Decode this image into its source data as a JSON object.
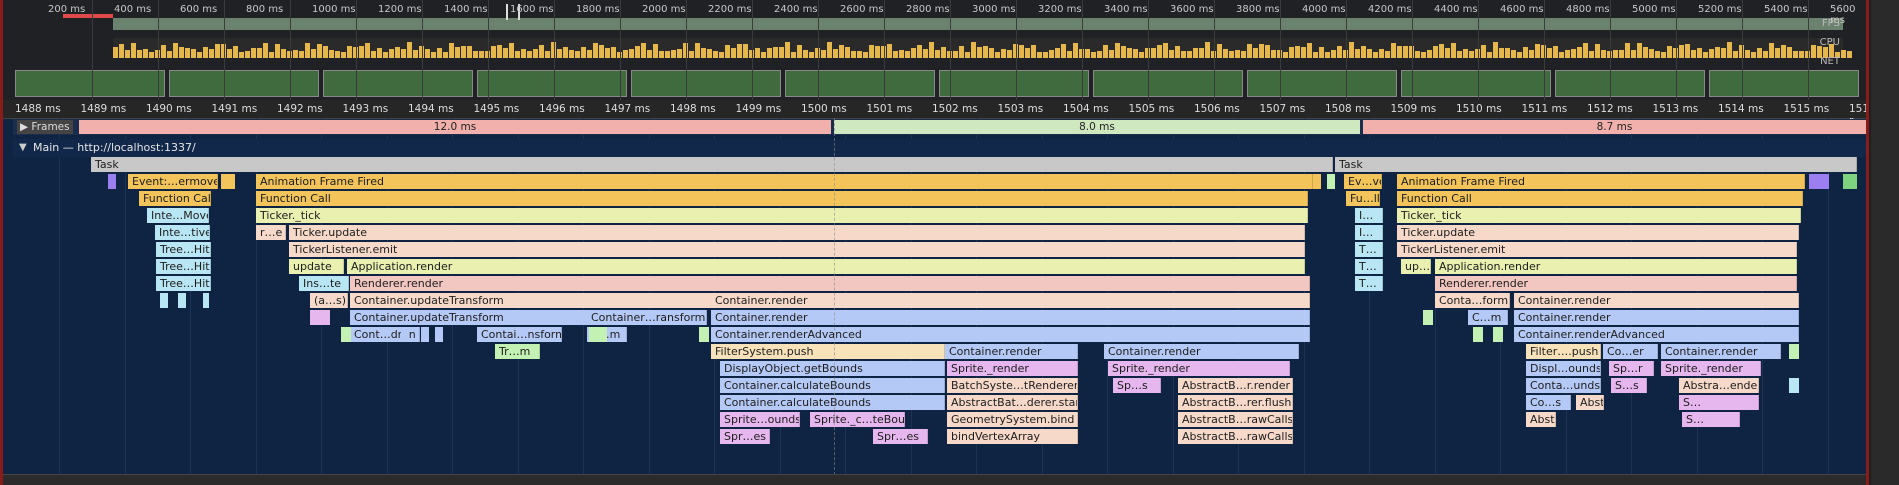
{
  "overview": {
    "ticks": [
      "200 ms",
      "400 ms",
      "600 ms",
      "800 ms",
      "1000 ms",
      "1200 ms",
      "1400 ms",
      "1600 ms",
      "1800 ms",
      "2000 ms",
      "2200 ms",
      "2400 ms",
      "2600 ms",
      "2800 ms",
      "3000 ms",
      "3200 ms",
      "3400 ms",
      "3600 ms",
      "3800 ms",
      "4000 ms",
      "4200 ms",
      "4400 ms",
      "4600 ms",
      "4800 ms",
      "5000 ms",
      "5200 ms",
      "5400 ms",
      "5600 ms"
    ],
    "fps_label": "FPS",
    "cpu_label": "CPU",
    "net_label": "NET",
    "colors": {
      "fps": "#a9d4ad",
      "cpu": "#e6b74a",
      "selection": "#5a5a5a"
    }
  },
  "ruler": {
    "ticks": [
      "1488 ms",
      "1489 ms",
      "1490 ms",
      "1491 ms",
      "1492 ms",
      "1493 ms",
      "1494 ms",
      "1495 ms",
      "1496 ms",
      "1497 ms",
      "1498 ms",
      "1499 ms",
      "1500 ms",
      "1501 ms",
      "1502 ms",
      "1503 ms",
      "1504 ms",
      "1505 ms",
      "1506 ms",
      "1507 ms",
      "1508 ms",
      "1509 ms",
      "1510 ms",
      "1511 ms",
      "1512 ms",
      "1513 ms",
      "1514 ms",
      "1515 ms",
      "1516 r"
    ]
  },
  "frames": {
    "label": "Frames",
    "cells": [
      "12.0 ms",
      "8.0 ms",
      "8.7 ms"
    ],
    "colors": {
      "dropped": "#f2b0ac",
      "ok": "#cfe8c0"
    }
  },
  "main": {
    "title": "Main — http://localhost:1337/"
  },
  "flame": {
    "task1": "Task",
    "task2": "Task",
    "blocks": [
      {
        "t": "Event:…ermove",
        "c": "#f2c45a"
      },
      {
        "t": "Function Call",
        "c": "#f2c45a"
      },
      {
        "t": "Inte…Move",
        "c": "#b9e6f4"
      },
      {
        "t": "Inte…tive",
        "c": "#b9e6f4"
      },
      {
        "t": "Tree…Hit",
        "c": "#b9e6f4"
      },
      {
        "t": "Tree…Hit",
        "c": "#b9e6f4"
      },
      {
        "t": "Tree…Hit",
        "c": "#b9e6f4"
      },
      {
        "t": "Animation Frame Fired",
        "c": "#f2c45a"
      },
      {
        "t": "Function Call",
        "c": "#f2c45a"
      },
      {
        "t": "Ticker._tick",
        "c": "#e9f0b0"
      },
      {
        "t": "r…e",
        "c": "#f6d9c9"
      },
      {
        "t": "Ticker.update",
        "c": "#f6d9c9"
      },
      {
        "t": "TickerListener.emit",
        "c": "#f6d9c9"
      },
      {
        "t": "update",
        "c": "#e9f0b0"
      },
      {
        "t": "Application.render",
        "c": "#e9f0b0"
      },
      {
        "t": "Ins…te",
        "c": "#b9e6f4"
      },
      {
        "t": "Renderer.render",
        "c": "#f2c6c1"
      },
      {
        "t": "(a…s)",
        "c": "#f6d9c9"
      },
      {
        "t": "Container.updateTransform",
        "c": "#f6d9c9"
      },
      {
        "t": "Container.render",
        "c": "#f6d9c9"
      },
      {
        "t": "Container.updateTransform",
        "c": "#b5c9f6"
      },
      {
        "t": "Container…ransform",
        "c": "#b5c9f6"
      },
      {
        "t": "Container.render",
        "c": "#b5c9f6"
      },
      {
        "t": "Cont…dren",
        "c": "#b5c9f6"
      },
      {
        "t": "Contai…nsform",
        "c": "#b5c9f6"
      },
      {
        "t": "C…m",
        "c": "#b5c9f6"
      },
      {
        "t": "Container.renderAdvanced",
        "c": "#b5c9f6"
      },
      {
        "t": "Tr…m",
        "c": "#c3f0b3"
      },
      {
        "t": "FilterSystem.push",
        "c": "#f7e2b9"
      },
      {
        "t": "Container.render",
        "c": "#b5c9f6"
      },
      {
        "t": "Container.render",
        "c": "#b5c9f6"
      },
      {
        "t": "DisplayObject.getBounds",
        "c": "#b5c9f6"
      },
      {
        "t": "Sprite._render",
        "c": "#e6b6ee"
      },
      {
        "t": "Sprite._render",
        "c": "#e6b6ee"
      },
      {
        "t": "Container.calculateBounds",
        "c": "#b5c9f6"
      },
      {
        "t": "BatchSyste…tRenderer",
        "c": "#f6d9c9"
      },
      {
        "t": "Sp…s",
        "c": "#e6b6ee"
      },
      {
        "t": "AbstractB…r.render",
        "c": "#f6d9c9"
      },
      {
        "t": "Container.calculateBounds",
        "c": "#b5c9f6"
      },
      {
        "t": "AbstractBat…derer.start",
        "c": "#f6d9c9"
      },
      {
        "t": "AbstractB…rer.flush",
        "c": "#f6d9c9"
      },
      {
        "t": "Sprite…ounds",
        "c": "#e6b6ee"
      },
      {
        "t": "Sprite._c…teBounds",
        "c": "#e6b6ee"
      },
      {
        "t": "GeometrySystem.bind",
        "c": "#f6d9c9"
      },
      {
        "t": "AbstractB…rawCalls",
        "c": "#f6d9c9"
      },
      {
        "t": "Spr…es",
        "c": "#e6b6ee"
      },
      {
        "t": "Spr…es",
        "c": "#e6b6ee"
      },
      {
        "t": "bindVertexArray",
        "c": "#f6d9c9"
      },
      {
        "t": "AbstractB…rawCalls",
        "c": "#f6d9c9"
      },
      {
        "t": "Ev…ve",
        "c": "#f2c45a"
      },
      {
        "t": "Fu…ll",
        "c": "#f2c45a"
      },
      {
        "t": "I…",
        "c": "#b9e6f4"
      },
      {
        "t": "I…",
        "c": "#b9e6f4"
      },
      {
        "t": "T…",
        "c": "#b9e6f4"
      },
      {
        "t": "T…",
        "c": "#b9e6f4"
      },
      {
        "t": "T…",
        "c": "#b9e6f4"
      },
      {
        "t": "Animation Frame Fired",
        "c": "#f2c45a"
      },
      {
        "t": "Function Call",
        "c": "#f2c45a"
      },
      {
        "t": "Ticker._tick",
        "c": "#e9f0b0"
      },
      {
        "t": "Ticker.update",
        "c": "#f6d9c9"
      },
      {
        "t": "TickerListener.emit",
        "c": "#f6d9c9"
      },
      {
        "t": "up…e",
        "c": "#e9f0b0"
      },
      {
        "t": "Application.render",
        "c": "#e9f0b0"
      },
      {
        "t": "Renderer.render",
        "c": "#f2c6c1"
      },
      {
        "t": "Conta…form",
        "c": "#f6d9c9"
      },
      {
        "t": "Container.render",
        "c": "#f6d9c9"
      },
      {
        "t": "C…m",
        "c": "#b5c9f6"
      },
      {
        "t": "Container.render",
        "c": "#b5c9f6"
      },
      {
        "t": "Container.renderAdvanced",
        "c": "#b5c9f6"
      },
      {
        "t": "Filter….push",
        "c": "#f7e2b9"
      },
      {
        "t": "Co…er",
        "c": "#b5c9f6"
      },
      {
        "t": "Container.render",
        "c": "#b5c9f6"
      },
      {
        "t": "Displ…ounds",
        "c": "#b5c9f6"
      },
      {
        "t": "Sp…r",
        "c": "#e6b6ee"
      },
      {
        "t": "Sprite._render",
        "c": "#e6b6ee"
      },
      {
        "t": "Conta…unds",
        "c": "#b5c9f6"
      },
      {
        "t": "S…s",
        "c": "#e6b6ee"
      },
      {
        "t": "Abstra…ender",
        "c": "#f6d9c9"
      },
      {
        "t": "Co…s",
        "c": "#b5c9f6"
      },
      {
        "t": "Abstra…flush",
        "c": "#f6d9c9"
      },
      {
        "t": "S…",
        "c": "#e6b6ee"
      },
      {
        "t": "Abstr…alls",
        "c": "#f6d9c9"
      },
      {
        "t": "S…",
        "c": "#e6b6ee"
      }
    ]
  }
}
